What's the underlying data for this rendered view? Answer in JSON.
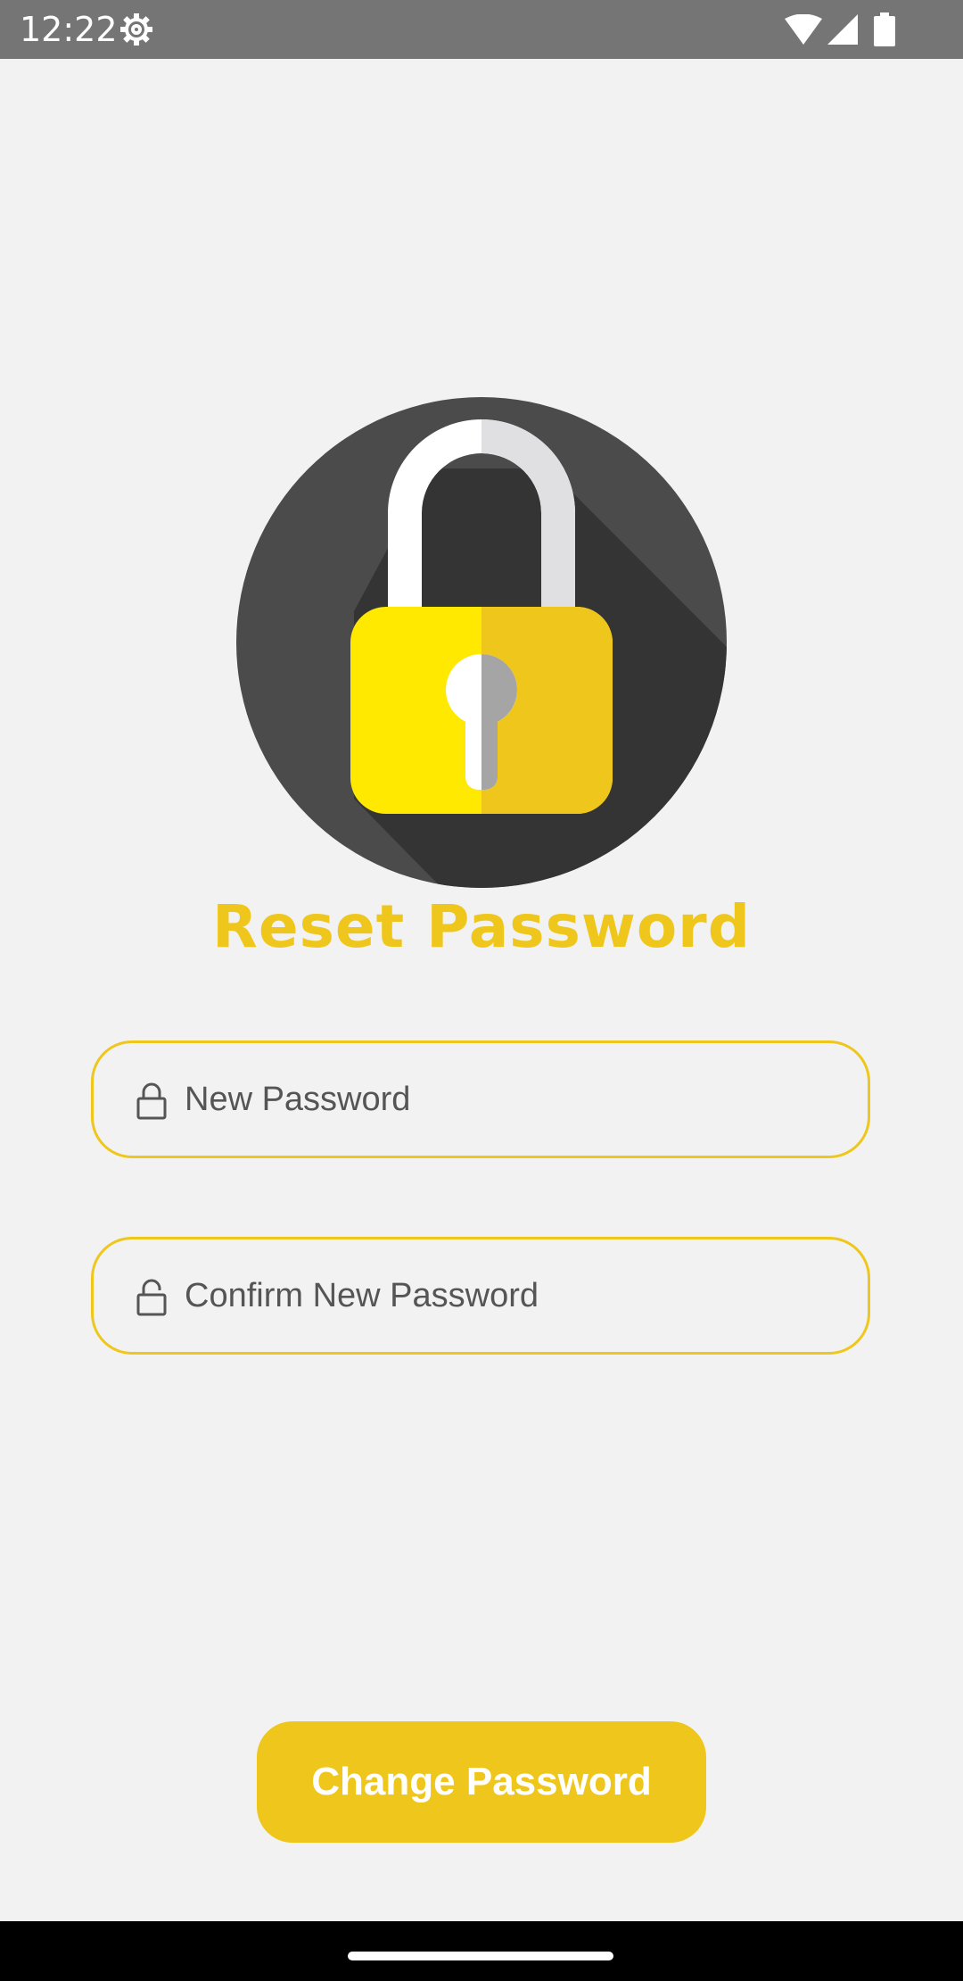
{
  "status_bar": {
    "time": "12:22",
    "icons": [
      "settings-gear-icon",
      "wifi-icon",
      "cell-signal-icon",
      "battery-icon"
    ]
  },
  "illustration": {
    "icon": "padlock-icon",
    "colors": {
      "circle": "#4b4b4b",
      "shadow": "#343434",
      "shackle_light": "#ffffff",
      "shackle_dark": "#e0e0e2",
      "body_light": "#ffe900",
      "body_dark": "#efc71c",
      "keyhole_light": "#ffffff",
      "keyhole_dark": "#a5a5a5"
    }
  },
  "page": {
    "title": "Reset Password"
  },
  "form": {
    "new_password": {
      "placeholder": "New Password",
      "icon": "lock-closed-icon"
    },
    "confirm_password": {
      "placeholder": "Confirm New Password",
      "icon": "lock-open-icon"
    }
  },
  "actions": {
    "submit_label": "Change Password"
  },
  "theme": {
    "accent": "#efc71c",
    "background": "#f2f2f2",
    "status_bar": "#757575"
  }
}
